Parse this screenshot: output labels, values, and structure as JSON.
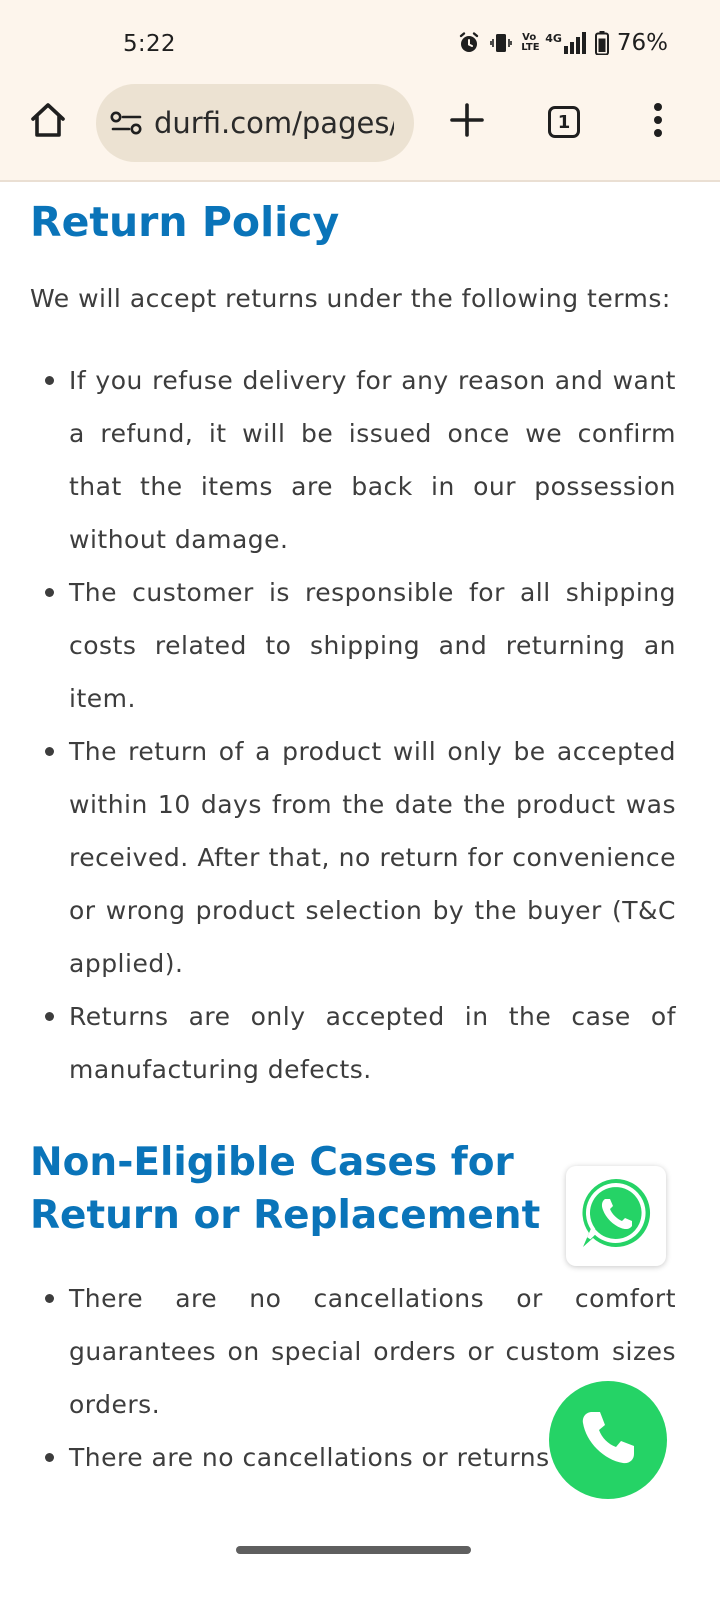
{
  "status_bar": {
    "time": "5:22",
    "network_label_top": "Vo",
    "network_label_bottom": "LTE",
    "data_type": "4G",
    "battery": "76%",
    "icons": [
      "alarm-icon",
      "vibrate-icon",
      "volte-icon",
      "signal-icon",
      "battery-icon"
    ]
  },
  "browser": {
    "url": "durfi.com/pages/",
    "tab_count": "1",
    "icons": [
      "home-icon",
      "site-settings-icon",
      "new-tab-icon",
      "tab-switcher-icon",
      "more-menu-icon"
    ]
  },
  "page": {
    "heading1": "Return Policy",
    "intro": "We will accept returns under the following terms:",
    "bullets1": [
      "If you refuse delivery for any reason and want a refund, it will be issued once we confirm that the items are back in our possession without damage.",
      "The customer is responsible for all shipping costs related to shipping and returning an item.",
      "The return of a product will only be accepted within 10 days from the date the product was received. After that, no return for convenience or wrong product selection by the buyer (T&C applied).",
      "Returns are only accepted in the case of manufacturing defects."
    ],
    "heading2": "Non-Eligible Cases for Return or Replacement",
    "bullets2": [
      "There are no cancellations or comfort guarantees on special orders or custom sizes orders.",
      "There are no cancellations or returns on"
    ]
  },
  "floating": {
    "whatsapp_icon": "whatsapp-icon",
    "call_icon": "phone-icon",
    "whatsapp_color": "#25d366",
    "call_color": "#25d366"
  },
  "colors": {
    "heading": "#0a74b9",
    "chrome_bg": "#fdf5ec",
    "url_bar_bg": "#ece2d2"
  }
}
